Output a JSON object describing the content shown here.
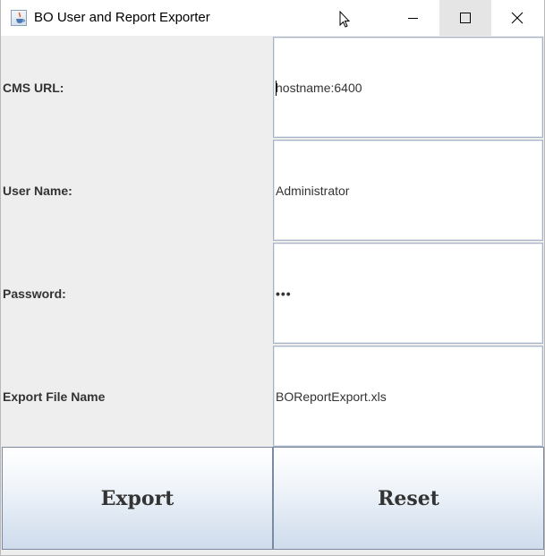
{
  "window": {
    "title": "BO User and Report Exporter",
    "icon": "java-cup-icon"
  },
  "form": {
    "cms_url": {
      "label": "CMS URL:",
      "value": "hostname:6400"
    },
    "user_name": {
      "label": "User Name:",
      "value": "Administrator"
    },
    "password": {
      "label": "Password:",
      "value": "•••"
    },
    "export_file": {
      "label": "Export File Name",
      "value": "BOReportExport.xls"
    }
  },
  "actions": {
    "export_label": "Export",
    "reset_label": "Reset"
  }
}
